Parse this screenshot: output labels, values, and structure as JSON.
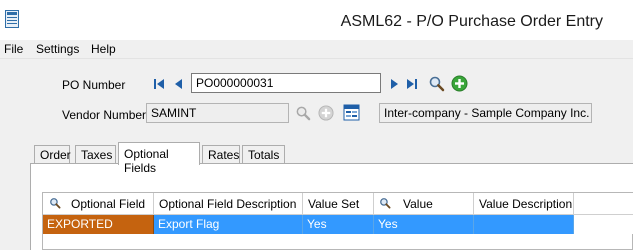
{
  "window": {
    "title": "ASML62 - P/O Purchase Order Entry"
  },
  "menu": {
    "file": "File",
    "settings": "Settings",
    "help": "Help"
  },
  "form": {
    "po_number_label": "PO Number",
    "po_number_value": "PO000000031",
    "vendor_number_label": "Vendor Number",
    "vendor_number_value": "SAMINT",
    "vendor_name": "Inter-company - Sample Company Inc."
  },
  "tabs": [
    {
      "label": "Order"
    },
    {
      "label": "Taxes"
    },
    {
      "label": "Optional Fields"
    },
    {
      "label": "Rates"
    },
    {
      "label": "Totals"
    }
  ],
  "grid": {
    "headers": [
      "Optional Field",
      "Optional Field Description",
      "Value Set",
      "Value",
      "Value Description"
    ],
    "rows": [
      {
        "optional_field": "EXPORTED",
        "description": "Export Flag",
        "value_set": "Yes",
        "value": "Yes",
        "value_description": ""
      }
    ]
  },
  "colors": {
    "selected_row": "#3399ff",
    "key_cell": "#c5630f",
    "add_icon": "#3aa63a"
  }
}
